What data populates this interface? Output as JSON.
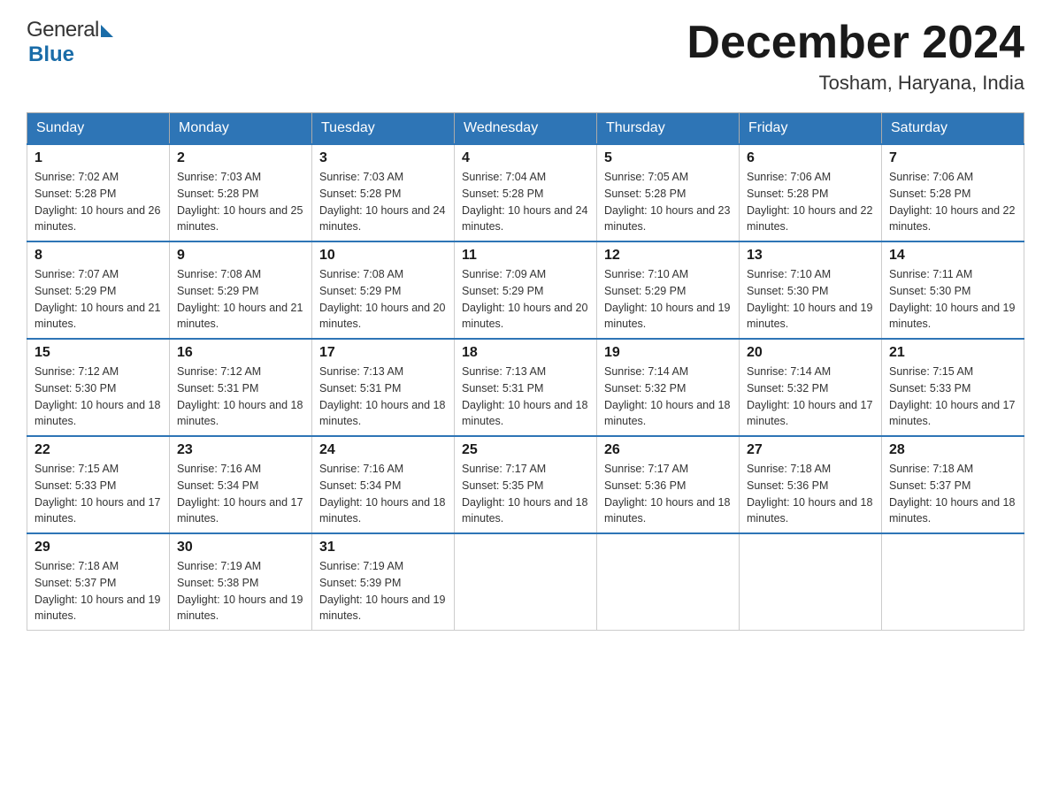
{
  "header": {
    "logo_general": "General",
    "logo_blue": "Blue",
    "title": "December 2024",
    "subtitle": "Tosham, Haryana, India"
  },
  "days": [
    "Sunday",
    "Monday",
    "Tuesday",
    "Wednesday",
    "Thursday",
    "Friday",
    "Saturday"
  ],
  "weeks": [
    [
      {
        "num": "1",
        "sunrise": "7:02 AM",
        "sunset": "5:28 PM",
        "daylight": "10 hours and 26 minutes."
      },
      {
        "num": "2",
        "sunrise": "7:03 AM",
        "sunset": "5:28 PM",
        "daylight": "10 hours and 25 minutes."
      },
      {
        "num": "3",
        "sunrise": "7:03 AM",
        "sunset": "5:28 PM",
        "daylight": "10 hours and 24 minutes."
      },
      {
        "num": "4",
        "sunrise": "7:04 AM",
        "sunset": "5:28 PM",
        "daylight": "10 hours and 24 minutes."
      },
      {
        "num": "5",
        "sunrise": "7:05 AM",
        "sunset": "5:28 PM",
        "daylight": "10 hours and 23 minutes."
      },
      {
        "num": "6",
        "sunrise": "7:06 AM",
        "sunset": "5:28 PM",
        "daylight": "10 hours and 22 minutes."
      },
      {
        "num": "7",
        "sunrise": "7:06 AM",
        "sunset": "5:28 PM",
        "daylight": "10 hours and 22 minutes."
      }
    ],
    [
      {
        "num": "8",
        "sunrise": "7:07 AM",
        "sunset": "5:29 PM",
        "daylight": "10 hours and 21 minutes."
      },
      {
        "num": "9",
        "sunrise": "7:08 AM",
        "sunset": "5:29 PM",
        "daylight": "10 hours and 21 minutes."
      },
      {
        "num": "10",
        "sunrise": "7:08 AM",
        "sunset": "5:29 PM",
        "daylight": "10 hours and 20 minutes."
      },
      {
        "num": "11",
        "sunrise": "7:09 AM",
        "sunset": "5:29 PM",
        "daylight": "10 hours and 20 minutes."
      },
      {
        "num": "12",
        "sunrise": "7:10 AM",
        "sunset": "5:29 PM",
        "daylight": "10 hours and 19 minutes."
      },
      {
        "num": "13",
        "sunrise": "7:10 AM",
        "sunset": "5:30 PM",
        "daylight": "10 hours and 19 minutes."
      },
      {
        "num": "14",
        "sunrise": "7:11 AM",
        "sunset": "5:30 PM",
        "daylight": "10 hours and 19 minutes."
      }
    ],
    [
      {
        "num": "15",
        "sunrise": "7:12 AM",
        "sunset": "5:30 PM",
        "daylight": "10 hours and 18 minutes."
      },
      {
        "num": "16",
        "sunrise": "7:12 AM",
        "sunset": "5:31 PM",
        "daylight": "10 hours and 18 minutes."
      },
      {
        "num": "17",
        "sunrise": "7:13 AM",
        "sunset": "5:31 PM",
        "daylight": "10 hours and 18 minutes."
      },
      {
        "num": "18",
        "sunrise": "7:13 AM",
        "sunset": "5:31 PM",
        "daylight": "10 hours and 18 minutes."
      },
      {
        "num": "19",
        "sunrise": "7:14 AM",
        "sunset": "5:32 PM",
        "daylight": "10 hours and 18 minutes."
      },
      {
        "num": "20",
        "sunrise": "7:14 AM",
        "sunset": "5:32 PM",
        "daylight": "10 hours and 17 minutes."
      },
      {
        "num": "21",
        "sunrise": "7:15 AM",
        "sunset": "5:33 PM",
        "daylight": "10 hours and 17 minutes."
      }
    ],
    [
      {
        "num": "22",
        "sunrise": "7:15 AM",
        "sunset": "5:33 PM",
        "daylight": "10 hours and 17 minutes."
      },
      {
        "num": "23",
        "sunrise": "7:16 AM",
        "sunset": "5:34 PM",
        "daylight": "10 hours and 17 minutes."
      },
      {
        "num": "24",
        "sunrise": "7:16 AM",
        "sunset": "5:34 PM",
        "daylight": "10 hours and 18 minutes."
      },
      {
        "num": "25",
        "sunrise": "7:17 AM",
        "sunset": "5:35 PM",
        "daylight": "10 hours and 18 minutes."
      },
      {
        "num": "26",
        "sunrise": "7:17 AM",
        "sunset": "5:36 PM",
        "daylight": "10 hours and 18 minutes."
      },
      {
        "num": "27",
        "sunrise": "7:18 AM",
        "sunset": "5:36 PM",
        "daylight": "10 hours and 18 minutes."
      },
      {
        "num": "28",
        "sunrise": "7:18 AM",
        "sunset": "5:37 PM",
        "daylight": "10 hours and 18 minutes."
      }
    ],
    [
      {
        "num": "29",
        "sunrise": "7:18 AM",
        "sunset": "5:37 PM",
        "daylight": "10 hours and 19 minutes."
      },
      {
        "num": "30",
        "sunrise": "7:19 AM",
        "sunset": "5:38 PM",
        "daylight": "10 hours and 19 minutes."
      },
      {
        "num": "31",
        "sunrise": "7:19 AM",
        "sunset": "5:39 PM",
        "daylight": "10 hours and 19 minutes."
      },
      null,
      null,
      null,
      null
    ]
  ]
}
